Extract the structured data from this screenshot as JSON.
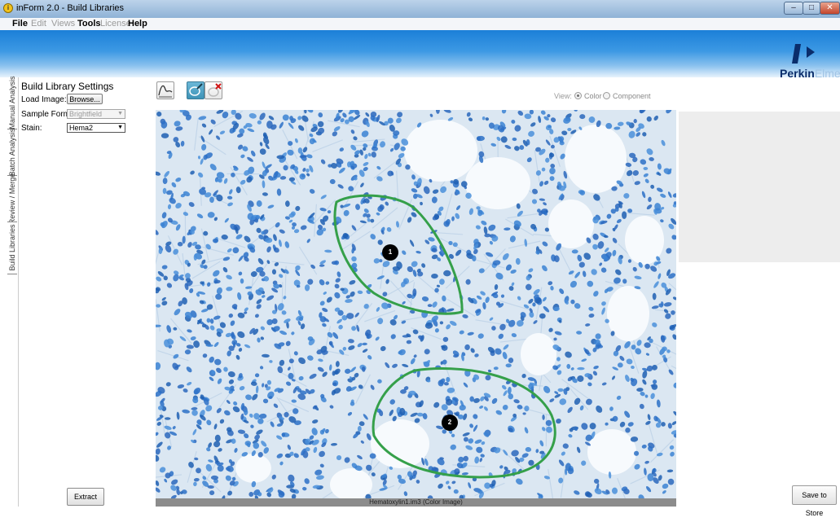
{
  "window": {
    "title": "inForm 2.0 - Build Libraries",
    "app_icon": "i",
    "minimize_icon": "–",
    "maximize_icon": "□",
    "close_icon": "✕"
  },
  "menu": {
    "file": "File",
    "edit": "Edit",
    "views": "Views",
    "tools": "Tools",
    "license": "License",
    "help": "Help"
  },
  "logo": {
    "text_bold": "Perkin",
    "text_faint": "Elmer"
  },
  "side_tabs": {
    "manual": "Manual Analysis",
    "batch": "Batch Analysis",
    "review": "Review / Merge",
    "build": "Build Libraries"
  },
  "settings": {
    "title": "Build Library Settings",
    "load_image_label": "Load Image:",
    "browse_label": "Browse...",
    "sample_format_label": "Sample Format:",
    "sample_format_value": "Brightfield",
    "stain_label": "Stain:",
    "stain_value": "Hema2",
    "extract_label": "Extract"
  },
  "view_toggle": {
    "label": "View:",
    "color": "Color",
    "component": "Component",
    "selected": "Color"
  },
  "image": {
    "caption": "Hematoxylin1.im3  (Color Image)",
    "roi_1": "1",
    "roi_2": "2"
  },
  "actions": {
    "save_to_store": "Save to Store"
  },
  "colors": {
    "banner": "#1b7fd8",
    "roi_outline": "#35a04a",
    "stain": "#2c70c7"
  }
}
